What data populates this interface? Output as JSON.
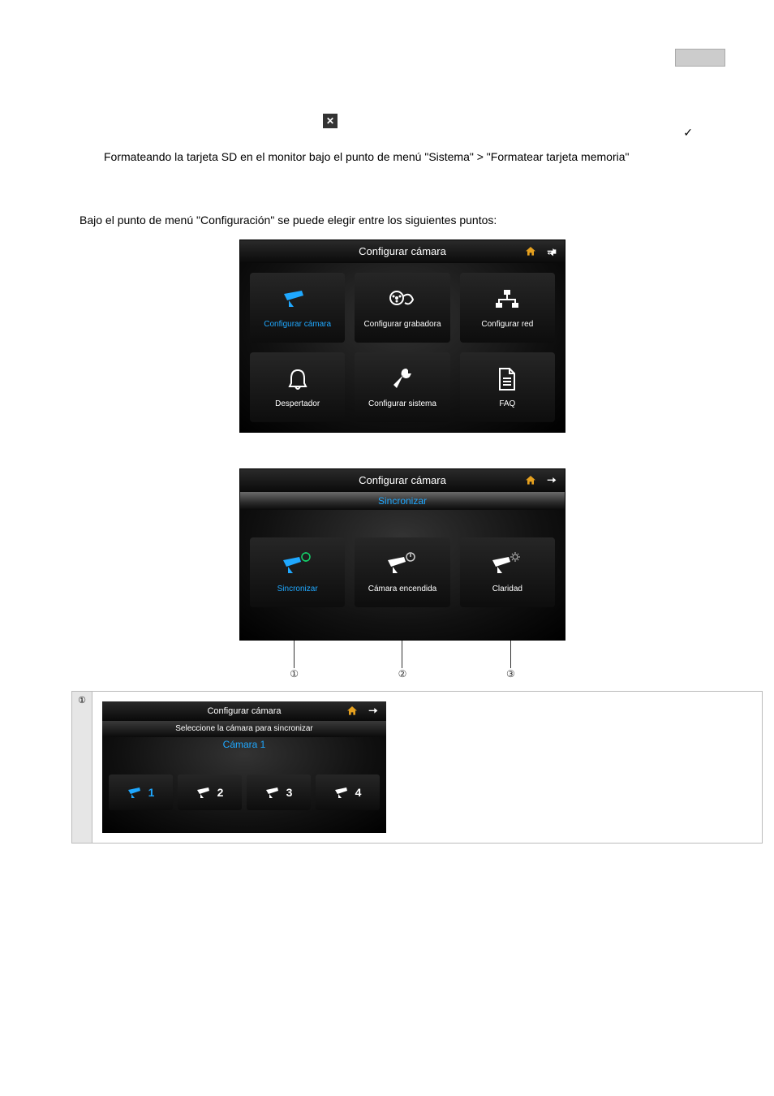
{
  "row1_text": "Formateando la tarjeta SD en el monitor bajo el punto de menú \"Sistema\" > \"Formatear tarjeta memoria\"",
  "row2_text": "Bajo el punto de menú \"Configuración\" se puede elegir entre los siguientes puntos:",
  "screen1": {
    "title": "Configurar cámara",
    "tiles": [
      {
        "label": "Configurar cámara",
        "selected": true
      },
      {
        "label": "Configurar grabadora",
        "selected": false
      },
      {
        "label": "Configurar red",
        "selected": false
      },
      {
        "label": "Despertador",
        "selected": false
      },
      {
        "label": "Configurar sistema",
        "selected": false
      },
      {
        "label": "FAQ",
        "selected": false
      }
    ]
  },
  "screen2": {
    "title": "Configurar cámara",
    "subtitle": "Sincronizar",
    "tiles": [
      {
        "label": "Sincronizar",
        "selected": true
      },
      {
        "label": "Cámara encendida",
        "selected": false
      },
      {
        "label": "Claridad",
        "selected": false
      }
    ]
  },
  "markers": [
    "①",
    "②",
    "③"
  ],
  "screen3": {
    "title": "Configurar cámara",
    "sub1": "Seleccione la cámara para sincronizar",
    "sub2": "Cámara 1",
    "cams": [
      "1",
      "2",
      "3",
      "4"
    ]
  },
  "table_num": "①"
}
